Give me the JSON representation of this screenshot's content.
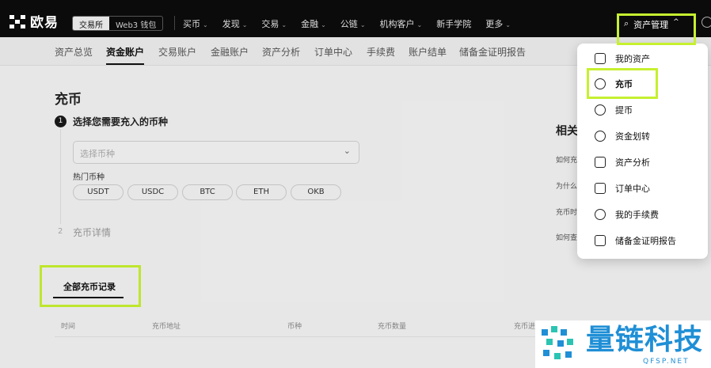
{
  "header": {
    "logo_text": "欧易",
    "segments": [
      "交易所",
      "Web3 钱包"
    ],
    "nav": [
      "买币",
      "发现",
      "交易",
      "金融",
      "公链",
      "机构客户",
      "新手学院",
      "更多"
    ],
    "asset_menu_label": "资产管理"
  },
  "subtabs": [
    "资产总览",
    "资金账户",
    "交易账户",
    "金融账户",
    "资产分析",
    "订单中心",
    "手续费",
    "账户结单",
    "储备金证明报告"
  ],
  "main": {
    "title": "充币",
    "step1_number": "1",
    "step1_title": "选择您需要充入的币种",
    "select_placeholder": "选择币种",
    "hot_label": "热门币种",
    "hot_coins": [
      "USDT",
      "USDC",
      "BTC",
      "ETH",
      "OKB"
    ],
    "step2_number": "2",
    "step2_title": "充币详情"
  },
  "records": {
    "tab_label": "全部充币记录",
    "columns": [
      "时间",
      "充币地址",
      "币种",
      "充币数量",
      "充币进"
    ]
  },
  "related": {
    "title": "相关",
    "items": [
      "如何充",
      "为什么",
      "充币时",
      "如何查"
    ]
  },
  "dropdown": {
    "items": [
      "我的资产",
      "充币",
      "提币",
      "资金划转",
      "资产分析",
      "订单中心",
      "我的手续费",
      "储备金证明报告"
    ]
  },
  "watermark": {
    "text": "量链科技",
    "sub": "QFSP.NET"
  },
  "colors": {
    "highlight": "#c6f02f",
    "topbar": "#0b0b0b",
    "watermark": "#1f8fd6"
  }
}
